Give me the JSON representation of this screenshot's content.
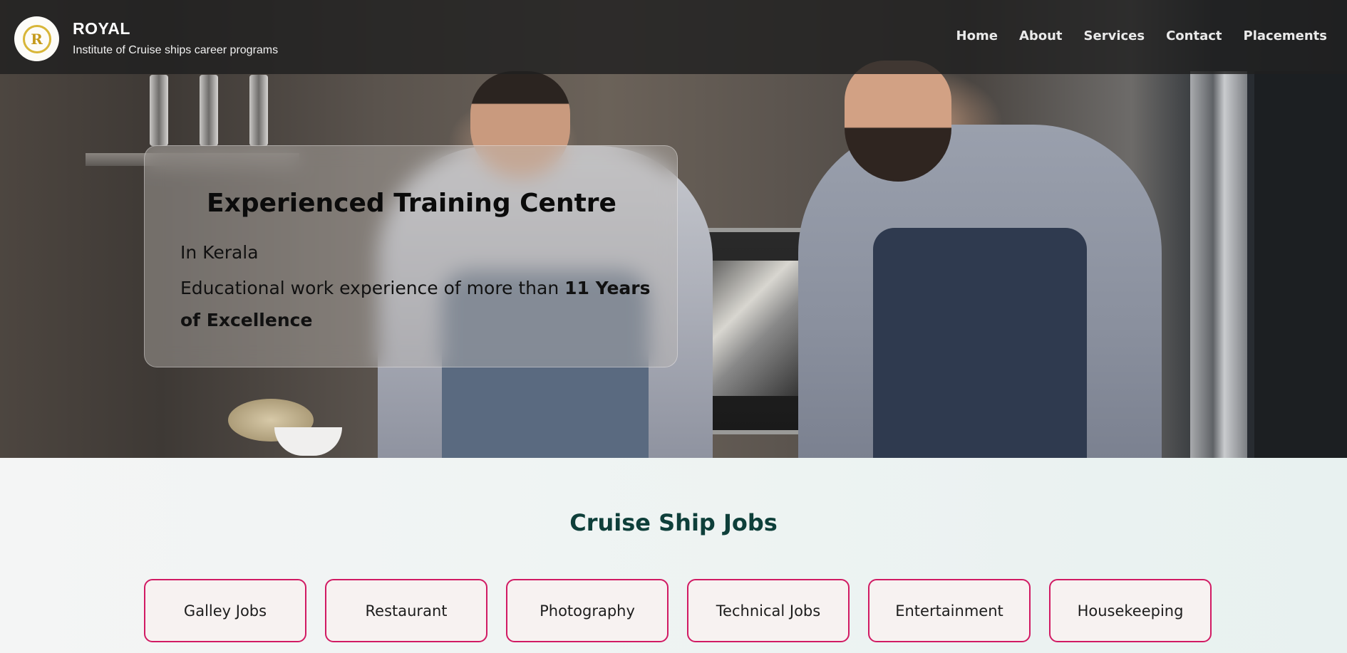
{
  "header": {
    "brand_title": "ROYAL",
    "brand_subtitle": "Institute of Cruise ships career programs",
    "logo_glyph": "R",
    "nav": [
      "Home",
      "About",
      "Services",
      "Contact",
      "Placements"
    ]
  },
  "hero": {
    "title": "Experienced Training Centre",
    "location": "In Kerala",
    "experience_prefix": "Educational work experience of more than ",
    "experience_highlight": "11 Years of Excellence"
  },
  "jobs": {
    "heading": "Cruise Ship Jobs",
    "items": [
      "Galley Jobs",
      "Restaurant",
      "Photography",
      "Technical Jobs",
      "Entertainment",
      "Housekeeping"
    ]
  },
  "colors": {
    "accent_border": "#d11a63",
    "heading": "#0e3f3a",
    "header_bg": "#202020"
  },
  "icons": {
    "logo": "royal-crest-icon"
  }
}
